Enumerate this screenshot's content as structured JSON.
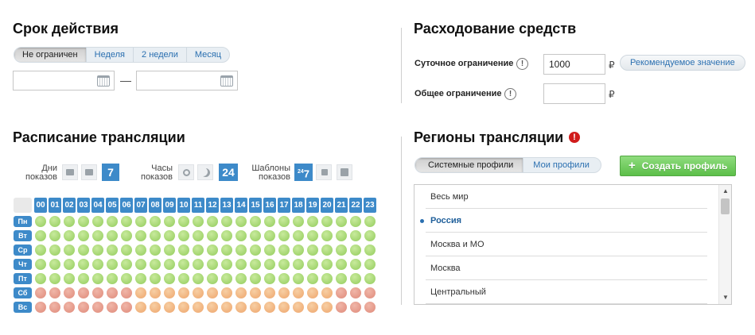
{
  "validity": {
    "title": "Срок действия",
    "periods": [
      {
        "label": "Не ограничен",
        "active": true
      },
      {
        "label": "Неделя",
        "active": false
      },
      {
        "label": "2 недели",
        "active": false
      },
      {
        "label": "Месяц",
        "active": false
      }
    ],
    "start_date": "",
    "end_date": "",
    "separator": "—"
  },
  "budget": {
    "title": "Расходование средств",
    "daily_label": "Суточное ограничение",
    "daily_value": "1000",
    "total_label": "Общее ограничение",
    "total_value": "",
    "currency": "₽",
    "help_glyph": "!",
    "recommended_button": "Рекомендуемое значение"
  },
  "schedule": {
    "title": "Расписание трансляции",
    "presets": [
      {
        "label_line1": "Дни",
        "label_line2": "показов",
        "icons": [
          "briefcase-icon",
          "sofa-icon"
        ],
        "number": "7"
      },
      {
        "label_line1": "Часы",
        "label_line2": "показов",
        "icons": [
          "sun-icon",
          "moon-icon"
        ],
        "number": "24"
      },
      {
        "label_line1": "Шаблоны",
        "label_line2": "показов",
        "icons": [
          "thumbs-up-icon",
          "edit-template-icon"
        ],
        "number": "7",
        "number_prefix": "24"
      }
    ],
    "hours": [
      "00",
      "01",
      "02",
      "03",
      "04",
      "05",
      "06",
      "07",
      "08",
      "09",
      "10",
      "11",
      "12",
      "13",
      "14",
      "15",
      "16",
      "17",
      "18",
      "19",
      "20",
      "21",
      "22",
      "23"
    ],
    "days": [
      "Пн",
      "Вт",
      "Ср",
      "Чт",
      "Пт",
      "Сб",
      "Вс"
    ],
    "colors": {
      "header": "#3d8ac9",
      "weekday": "green",
      "weekend_mid": "orange",
      "weekend_edge": "red"
    }
  },
  "regions": {
    "title": "Регионы трансляции",
    "alert_glyph": "!",
    "tabs": [
      {
        "label": "Системные профили",
        "active": true
      },
      {
        "label": "Мои профили",
        "active": false
      }
    ],
    "create_button": "Создать профиль",
    "create_glyph": "+",
    "items": [
      {
        "label": "Весь мир",
        "selected": false
      },
      {
        "label": "Россия",
        "selected": true
      },
      {
        "label": "Москва и МО",
        "selected": false
      },
      {
        "label": "Москва",
        "selected": false
      },
      {
        "label": "Центральный",
        "selected": false
      }
    ]
  }
}
